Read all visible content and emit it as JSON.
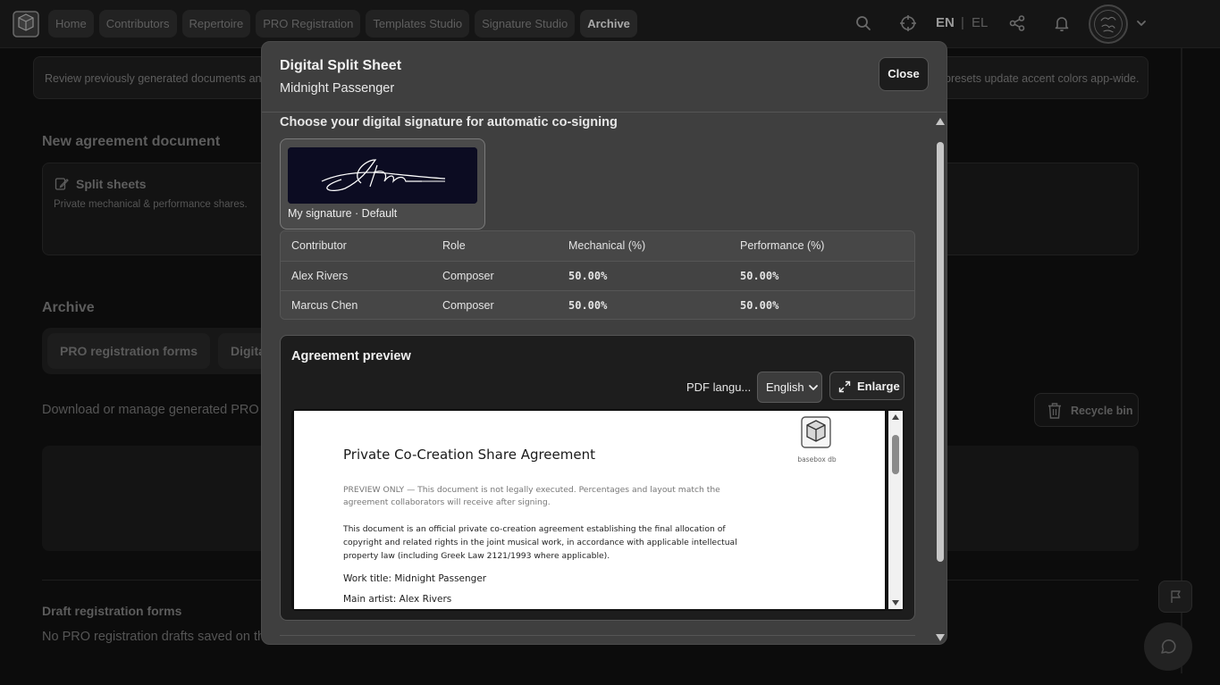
{
  "nav": {
    "tabs": [
      {
        "label": "Home"
      },
      {
        "label": "Contributors"
      },
      {
        "label": "Repertoire"
      },
      {
        "label": "PRO Registration"
      },
      {
        "label": "Templates Studio"
      },
      {
        "label": "Signature Studio"
      },
      {
        "label": "Archive",
        "active": true
      }
    ],
    "lang_en": "EN",
    "lang_sep": "|",
    "lang_el": "EL",
    "icons": [
      "search-icon",
      "crosshair-icon",
      "share-icon",
      "bell-icon",
      "chevron-down-icon"
    ]
  },
  "background": {
    "info_left": "Review previously generated documents and",
    "info_right": "presets update accent colors app-wide.",
    "new_doc_title": "New agreement document",
    "card_title": "Split sheets",
    "card_desc": "Private mechanical & performance shares.",
    "archive_title": "Archive",
    "archive_tab_1": "PRO registration forms",
    "archive_tab_2": "Digita",
    "download_text": "Download or manage generated PRO r",
    "recycle_label": "Recycle bin",
    "drafts_title": "Draft registration forms",
    "drafts_text": "No PRO registration drafts saved on thi"
  },
  "modal": {
    "title": "Digital Split Sheet",
    "subtitle": "Midnight Passenger",
    "close_label": "Close",
    "signature_heading": "Choose your digital signature for automatic co-signing",
    "signature_label": "My signature · Default",
    "table": {
      "headers": [
        "Contributor",
        "Role",
        "Mechanical (%)",
        "Performance (%)"
      ],
      "rows": [
        [
          "Alex Rivers",
          "Composer",
          "50.00%",
          "50.00%"
        ],
        [
          "Marcus Chen",
          "Composer",
          "50.00%",
          "50.00%"
        ]
      ]
    },
    "preview": {
      "title": "Agreement preview",
      "pdf_lang_label": "PDF langu...",
      "lang_value": "English",
      "enlarge_label": "Enlarge",
      "doc": {
        "logo_text": "basebox db",
        "title": "Private Co-Creation Share Agreement",
        "note": "PREVIEW ONLY — This document is not legally executed. Percentages and layout match the agreement collaborators will receive after signing.",
        "body": "This document is an official private co-creation agreement establishing the final allocation of copyright and related rights in the joint musical work, in accordance with applicable intellectual property law (including Greek Law 2121/1993 where applicable).",
        "work_title": "Work title: Midnight Passenger",
        "main_artist": "Main artist: Alex Rivers"
      }
    }
  }
}
